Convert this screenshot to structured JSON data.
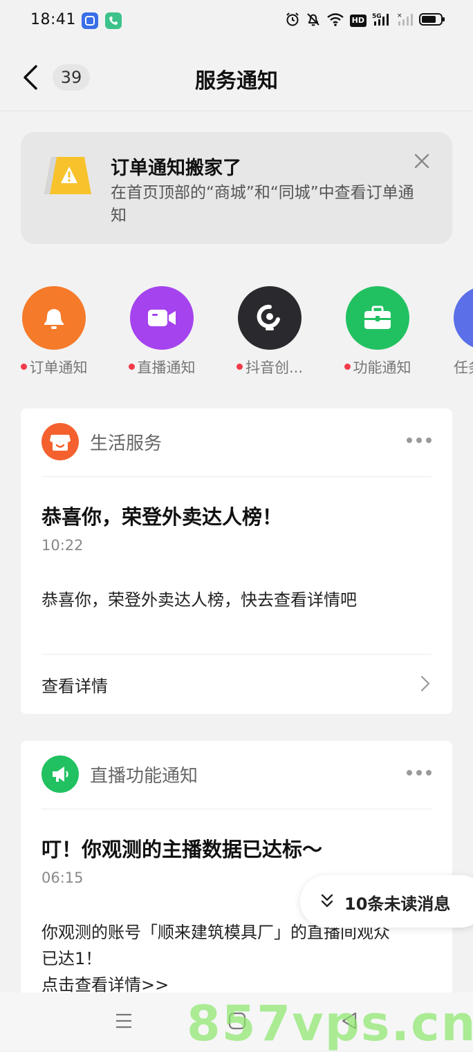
{
  "status_bar": {
    "time": "18:41",
    "icons": [
      "app-square-icon",
      "phone-app-icon",
      "alarm-icon",
      "mute-bell-icon",
      "wifi-icon",
      "hd-icon",
      "signal-5g-icon",
      "signal-icon",
      "battery-icon"
    ],
    "hd_label": "HD",
    "net_label": "5G"
  },
  "header": {
    "back_icon": "chevron-left-icon",
    "unread_count": "39",
    "title": "服务通知"
  },
  "banner": {
    "title": "订单通知搬家了",
    "description": "在首页顶部的“商城”和“同城”中查看订单通知",
    "icon": "warning-sign-icon",
    "close_icon": "close-icon"
  },
  "shortcuts": [
    {
      "label": "订单通知",
      "icon": "bell-icon",
      "color": "#f57a2a",
      "unread_dot": true
    },
    {
      "label": "直播通知",
      "icon": "video-camera-icon",
      "color": "#a543ee",
      "unread_dot": true
    },
    {
      "label": "抖音创...",
      "icon": "creator-bulb-icon",
      "color": "#2a2a2e",
      "unread_dot": true
    },
    {
      "label": "功能通知",
      "icon": "briefcase-icon",
      "color": "#21c161",
      "unread_dot": true
    },
    {
      "label": "任务",
      "icon": "task-icon",
      "color": "#5a6fe8",
      "unread_dot": false
    }
  ],
  "cards": [
    {
      "source": "生活服务",
      "avatar_icon": "shop-icon",
      "avatar_color": "#f4612e",
      "title": "恭喜你，荣登外卖达人榜！",
      "time": "10:22",
      "body": "恭喜你，荣登外卖达人榜，快去查看详情吧",
      "link": "查看详情"
    },
    {
      "source": "直播功能通知",
      "avatar_icon": "megaphone-icon",
      "avatar_color": "#21c161",
      "title": "叮！你观测的主播数据已达标～",
      "time": "06:15",
      "body_line1": "你观测的账号「顺来建筑模具厂」的直播间观众",
      "body_line2": "已达1！",
      "body_line3": "点击查看详情>>"
    }
  ],
  "unread_pill": {
    "text": "10条未读消息",
    "icon": "double-chevron-down-icon"
  },
  "bottom_nav": {
    "icons": [
      "menu-icon",
      "home-square-icon",
      "back-triangle-icon"
    ]
  },
  "watermark": "857vps.cn",
  "colors": {
    "accent_red_dot": "#f23a4a",
    "background": "#f2f2f2"
  }
}
